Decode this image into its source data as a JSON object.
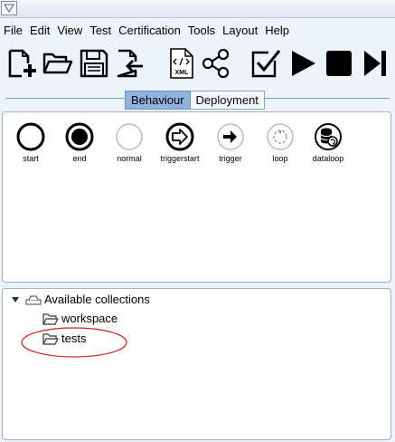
{
  "menubar": {
    "items": [
      "File",
      "Edit",
      "View",
      "Test",
      "Certification",
      "Tools",
      "Layout",
      "Help"
    ]
  },
  "toolbar": {
    "buttons": [
      {
        "name": "new-file",
        "icon": "new-file-icon"
      },
      {
        "name": "open-folder",
        "icon": "open-folder-icon"
      },
      {
        "name": "save",
        "icon": "floppy-disk-icon"
      },
      {
        "name": "import",
        "icon": "import-file-icon"
      },
      {
        "name": "xml",
        "icon": "xml-file-icon",
        "badge": "XML"
      },
      {
        "name": "share",
        "icon": "share-icon"
      },
      {
        "name": "certify",
        "icon": "checkbox-check-icon"
      },
      {
        "name": "run",
        "icon": "play-icon"
      },
      {
        "name": "stop",
        "icon": "stop-icon"
      },
      {
        "name": "step",
        "icon": "step-forward-icon"
      }
    ]
  },
  "tabs": [
    {
      "label": "Behaviour",
      "active": true
    },
    {
      "label": "Deployment",
      "active": false
    }
  ],
  "palette": {
    "items": [
      {
        "label": "start",
        "icon": "start-circle-icon"
      },
      {
        "label": "end",
        "icon": "end-circle-icon"
      },
      {
        "label": "normal",
        "icon": "normal-circle-icon"
      },
      {
        "label": "triggerstart",
        "icon": "triggerstart-icon"
      },
      {
        "label": "trigger",
        "icon": "trigger-icon"
      },
      {
        "label": "loop",
        "icon": "loop-icon"
      },
      {
        "label": "dataloop",
        "icon": "dataloop-icon"
      }
    ]
  },
  "tree": {
    "root": {
      "label": "Available collections",
      "expanded": true
    },
    "children": [
      {
        "label": "workspace"
      },
      {
        "label": "tests"
      }
    ]
  },
  "annotation": {
    "color": "#cc2222",
    "target": "tests"
  }
}
